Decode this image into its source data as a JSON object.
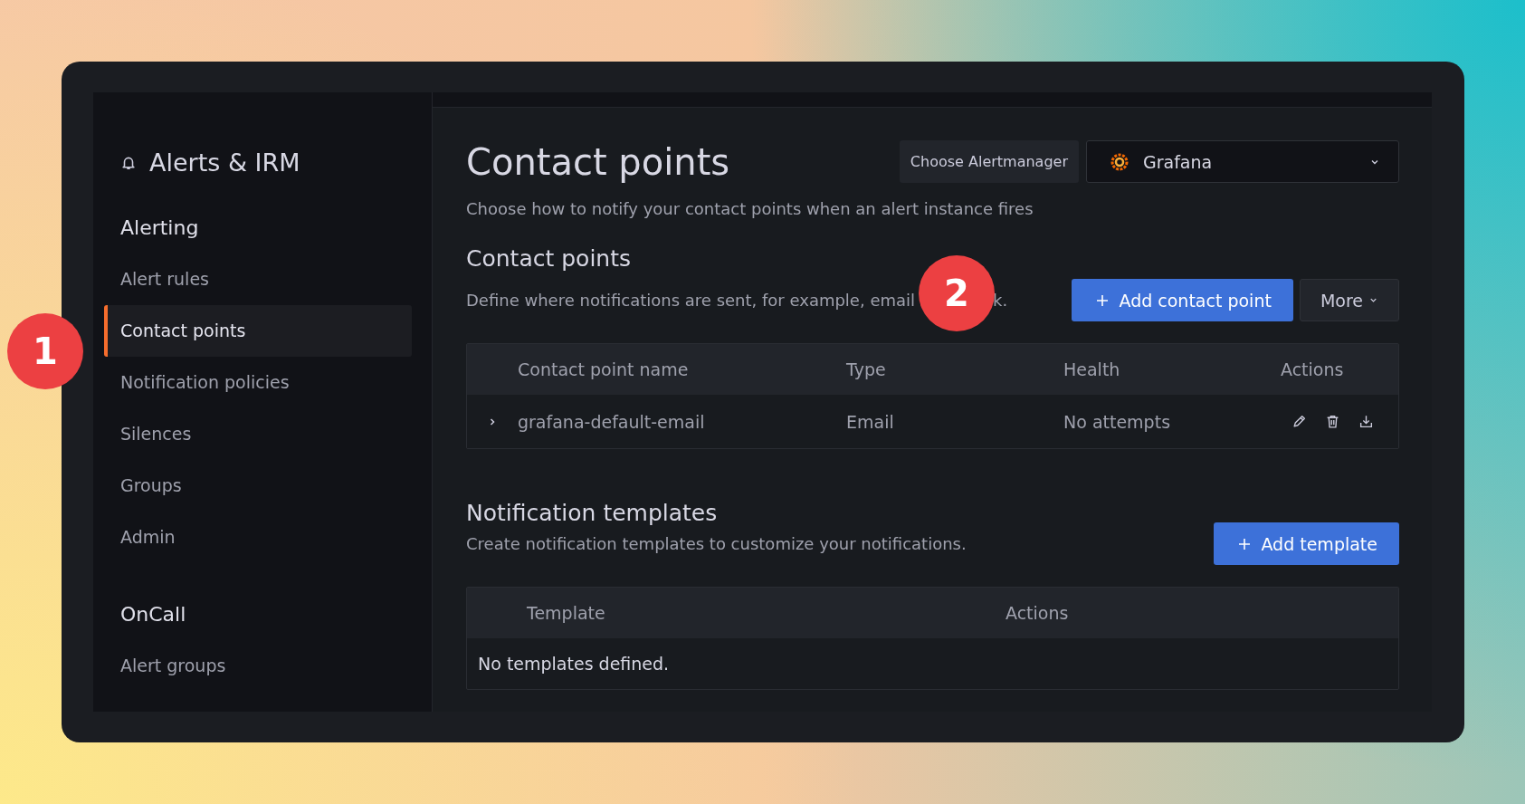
{
  "sidebar": {
    "title": "Alerts & IRM",
    "sections": [
      {
        "heading": "Alerting",
        "items": [
          {
            "label": "Alert rules",
            "selected": false
          },
          {
            "label": "Contact points",
            "selected": true
          },
          {
            "label": "Notification policies",
            "selected": false
          },
          {
            "label": "Silences",
            "selected": false
          },
          {
            "label": "Groups",
            "selected": false
          },
          {
            "label": "Admin",
            "selected": false
          }
        ]
      },
      {
        "heading": "OnCall",
        "items": [
          {
            "label": "Alert groups",
            "selected": false
          }
        ]
      }
    ]
  },
  "header": {
    "title": "Contact points",
    "alertmanager_label": "Choose Alertmanager",
    "alertmanager_value": "Grafana",
    "subtitle": "Choose how to notify your contact points when an alert instance fires"
  },
  "contact_points": {
    "title": "Contact points",
    "description": "Define where notifications are sent, for example, email",
    "description_tail": "k.",
    "add_button": "Add contact point",
    "more_button": "More",
    "columns": [
      "Contact point name",
      "Type",
      "Health",
      "Actions"
    ],
    "rows": [
      {
        "expanded": false,
        "name": "grafana-default-email",
        "type": "Email",
        "health": "No attempts"
      }
    ]
  },
  "templates": {
    "title": "Notification templates",
    "description": "Create notification templates to customize your notifications.",
    "add_button": "Add template",
    "columns": [
      "Template",
      "Actions"
    ],
    "empty": "No templates defined."
  },
  "callouts": [
    {
      "number": "1"
    },
    {
      "number": "2"
    }
  ]
}
